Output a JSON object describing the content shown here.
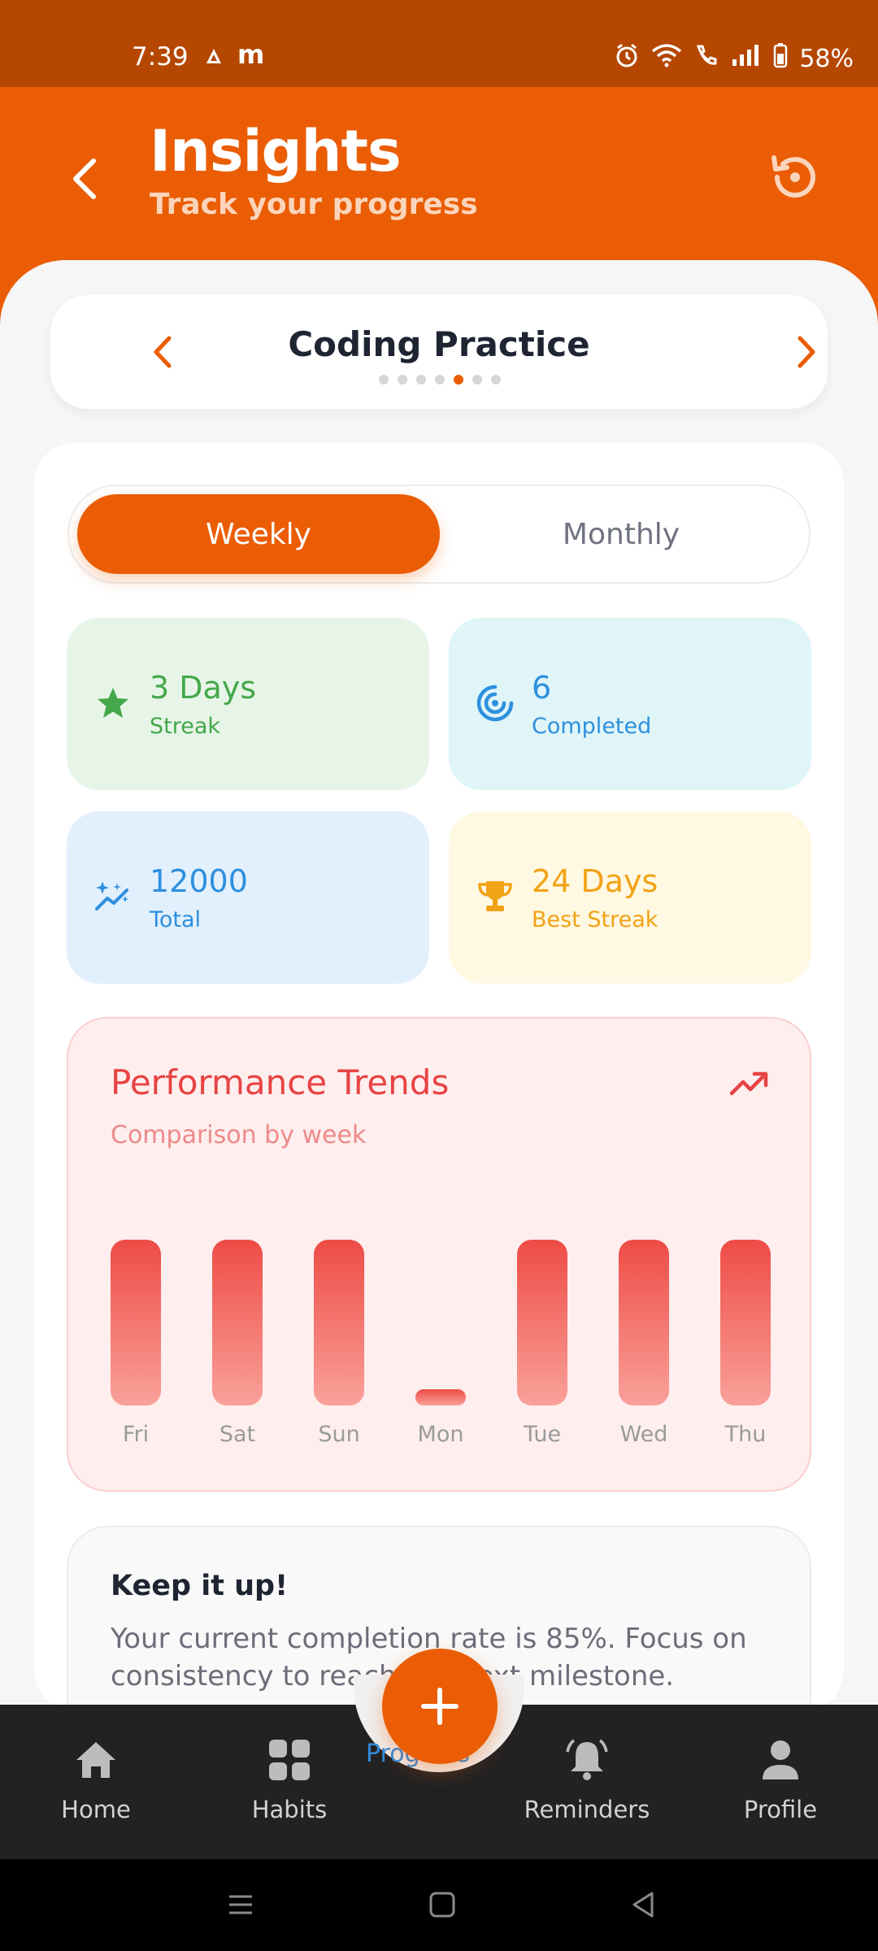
{
  "status_bar": {
    "time": "7:39",
    "battery": "58%",
    "icons": [
      "signal-icon-a",
      "m-icon",
      "alarm-icon",
      "wifi-icon",
      "call-icon",
      "cell-signal-icon",
      "battery-icon"
    ]
  },
  "header": {
    "title": "Insights",
    "subtitle": "Track your progress",
    "icons": [
      "back-arrow-icon",
      "reset-icon"
    ]
  },
  "habit": {
    "name": "Coding Practice",
    "dots": 7,
    "active_dot": 4
  },
  "toggle": {
    "weekly": "Weekly",
    "monthly": "Monthly",
    "selected": "Weekly"
  },
  "stats": [
    {
      "value": "3 Days",
      "label": "Streak",
      "icon": "star-icon",
      "color": "#44a84a"
    },
    {
      "value": "6",
      "label": "Completed",
      "icon": "target-icon",
      "color": "#2d90dd"
    },
    {
      "value": "12000",
      "label": "Total",
      "icon": "sparkle-trend-icon",
      "color": "#2d8fdf"
    },
    {
      "value": "24 Days",
      "label": "Best Streak",
      "icon": "trophy-icon",
      "color": "#f2a215"
    }
  ],
  "trends": {
    "title": "Performance Trends",
    "subtitle": "Comparison by week",
    "icon": "trending-up-icon"
  },
  "chart_data": {
    "type": "bar",
    "categories": [
      "Fri",
      "Sat",
      "Sun",
      "Mon",
      "Tue",
      "Wed",
      "Thu"
    ],
    "values": [
      1,
      1,
      1,
      0,
      1,
      1,
      1
    ],
    "ylim": [
      0,
      1
    ]
  },
  "tip": {
    "title": "Keep it up!",
    "body": "Your current completion rate is 85%. Focus on consistency to reach the next milestone."
  },
  "nav": {
    "items": [
      {
        "label": "Home",
        "icon": "home-icon"
      },
      {
        "label": "Habits",
        "icon": "grid-icon"
      },
      {
        "label": "Reminders",
        "icon": "bell-icon"
      },
      {
        "label": "Profile",
        "icon": "person-icon"
      }
    ],
    "center_label": "Progress",
    "fab_icon": "plus-icon"
  },
  "colors": {
    "accent": "#ea5d04",
    "status_bar": "#b54700",
    "trend_red": "#e84343"
  }
}
